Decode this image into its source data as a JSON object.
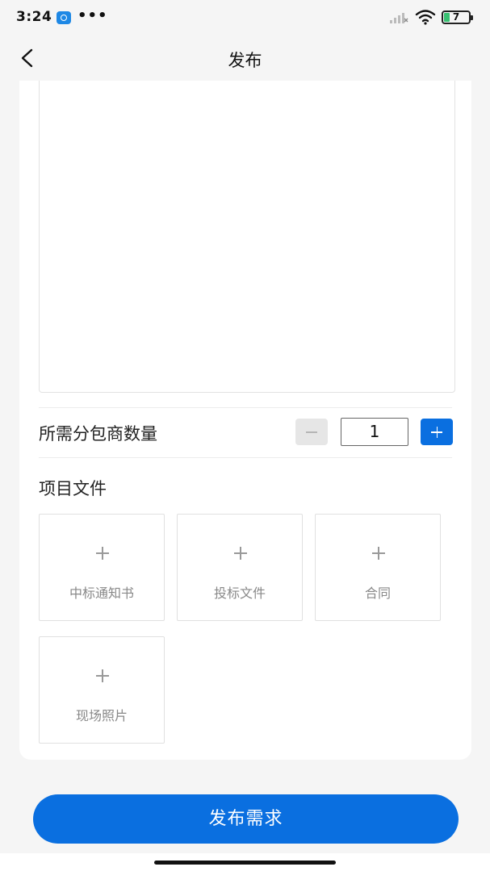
{
  "status_bar": {
    "time": "3:24",
    "more": "•••",
    "battery_level": "7",
    "icons": [
      "app-notification-icon",
      "signal-icon",
      "wifi-icon",
      "battery-icon"
    ]
  },
  "nav": {
    "title": "发布",
    "back_icon": "chevron-left-icon"
  },
  "form": {
    "description_value": "",
    "quantity": {
      "label": "所需分包商数量",
      "value": "1"
    },
    "files": {
      "title": "项目文件",
      "items": [
        {
          "label": "中标通知书",
          "icon": "plus-icon"
        },
        {
          "label": "投标文件",
          "icon": "plus-icon"
        },
        {
          "label": "合同",
          "icon": "plus-icon"
        },
        {
          "label": "现场照片",
          "icon": "plus-icon"
        }
      ]
    }
  },
  "actions": {
    "publish_label": "发布需求"
  },
  "colors": {
    "accent": "#0a6fe0",
    "background": "#f5f5f5",
    "card": "#ffffff"
  }
}
